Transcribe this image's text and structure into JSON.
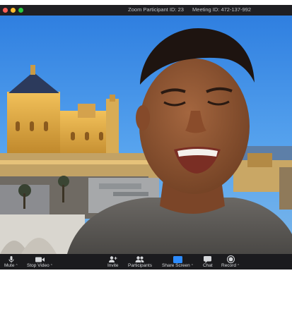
{
  "window": {
    "traffic_lights": [
      "#ff5f57",
      "#febc2e",
      "#28c840"
    ],
    "participant_id": "Zoom Participant ID: 23",
    "meeting_id": "Meeting ID: 472-137-992"
  },
  "toolbar": {
    "mute": {
      "label": "Mute",
      "icon": "microphone-icon"
    },
    "stop_video": {
      "label": "Stop Video",
      "icon": "video-camera-icon"
    },
    "invite": {
      "label": "Invite",
      "icon": "add-person-icon"
    },
    "participants": {
      "label": "Participants",
      "icon": "people-icon"
    },
    "share_screen": {
      "label": "Share Screen",
      "icon": "share-screen-icon",
      "color": "#2d8cff"
    },
    "chat": {
      "label": "Chat",
      "icon": "chat-bubble-icon"
    },
    "record": {
      "label": "Record",
      "icon": "record-icon"
    },
    "caret": "⌃"
  }
}
